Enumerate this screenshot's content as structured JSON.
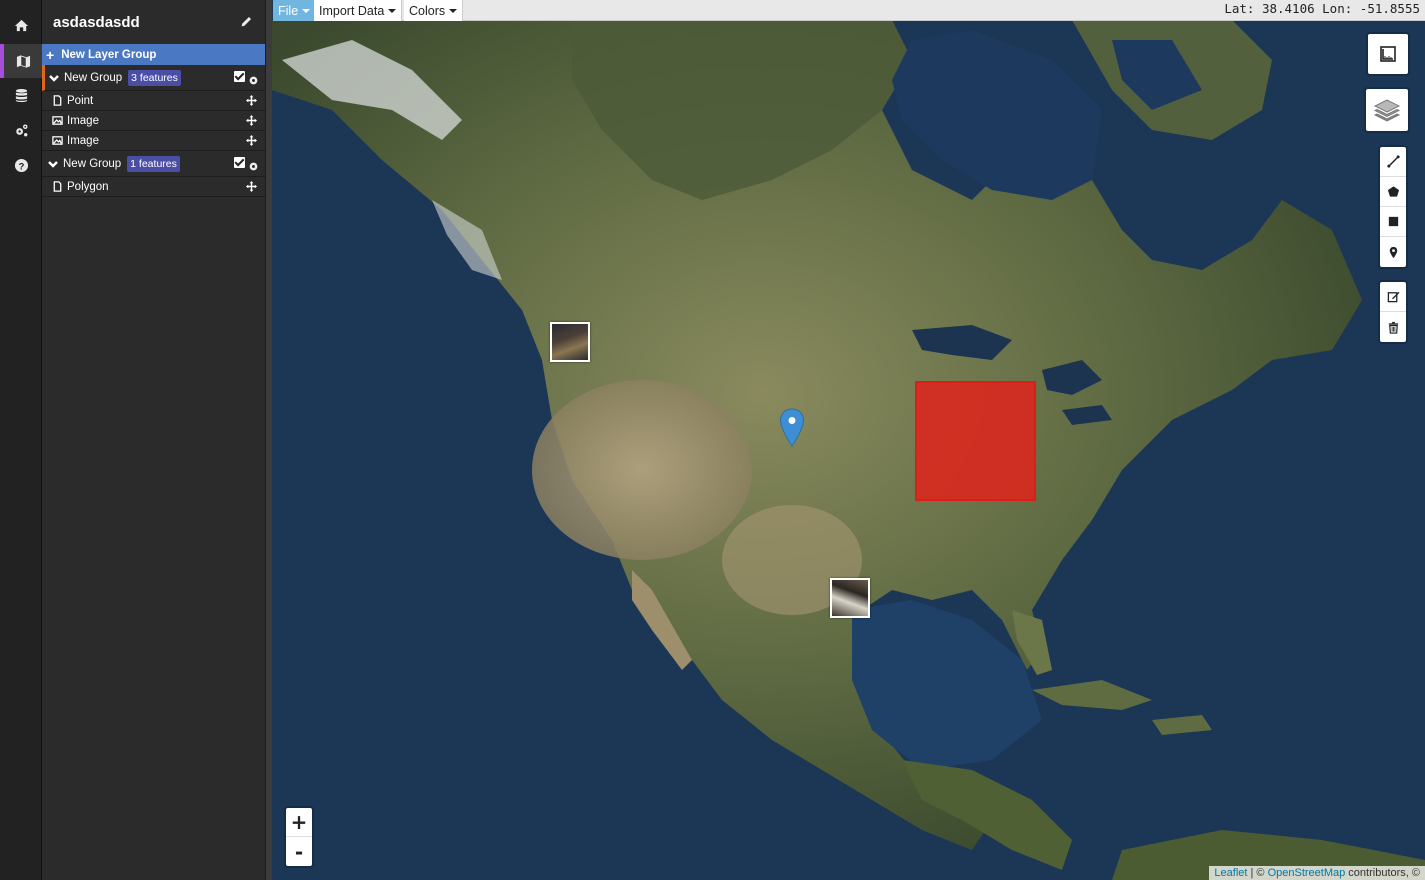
{
  "rail": {
    "items": [
      {
        "name": "home",
        "icon": "home-icon"
      },
      {
        "name": "map",
        "icon": "map-icon",
        "active": true
      },
      {
        "name": "data",
        "icon": "database-icon"
      },
      {
        "name": "settings",
        "icon": "gears-icon"
      },
      {
        "name": "help",
        "icon": "question-icon"
      }
    ]
  },
  "panel": {
    "project_title": "asdasdasdd",
    "new_layer_group_label": "New Layer Group",
    "groups": [
      {
        "label": "New Group",
        "badge": "3 features",
        "items": [
          {
            "label": "Point",
            "icon": "file-icon"
          },
          {
            "label": "Image",
            "icon": "image-icon"
          },
          {
            "label": "Image",
            "icon": "image-icon"
          }
        ]
      },
      {
        "label": "New Group",
        "badge": "1 features",
        "items": [
          {
            "label": "Polygon",
            "icon": "file-icon"
          }
        ]
      }
    ]
  },
  "menubar": {
    "file": "File",
    "import": "Import Data",
    "colors": "Colors"
  },
  "coords": "Lat: 38.4106 Lon: -51.8555",
  "map_controls": {
    "zoom_in": "+",
    "zoom_out": "-",
    "draw_tools": [
      "polyline-icon",
      "polygon-icon",
      "rectangle-icon",
      "marker-icon"
    ],
    "edit_tools": [
      "edit-icon",
      "trash-icon"
    ]
  },
  "attribution": {
    "leaflet": "Leaflet",
    "sep": " | © ",
    "osm": "OpenStreetMap",
    "rest": " contributors, ©"
  },
  "colors": {
    "accent": "#4a78c2",
    "badge": "#4b4ea5",
    "polygon_fill": "#e0231b",
    "marker": "#3e8ed6",
    "active_menu": "#70b6e0"
  }
}
